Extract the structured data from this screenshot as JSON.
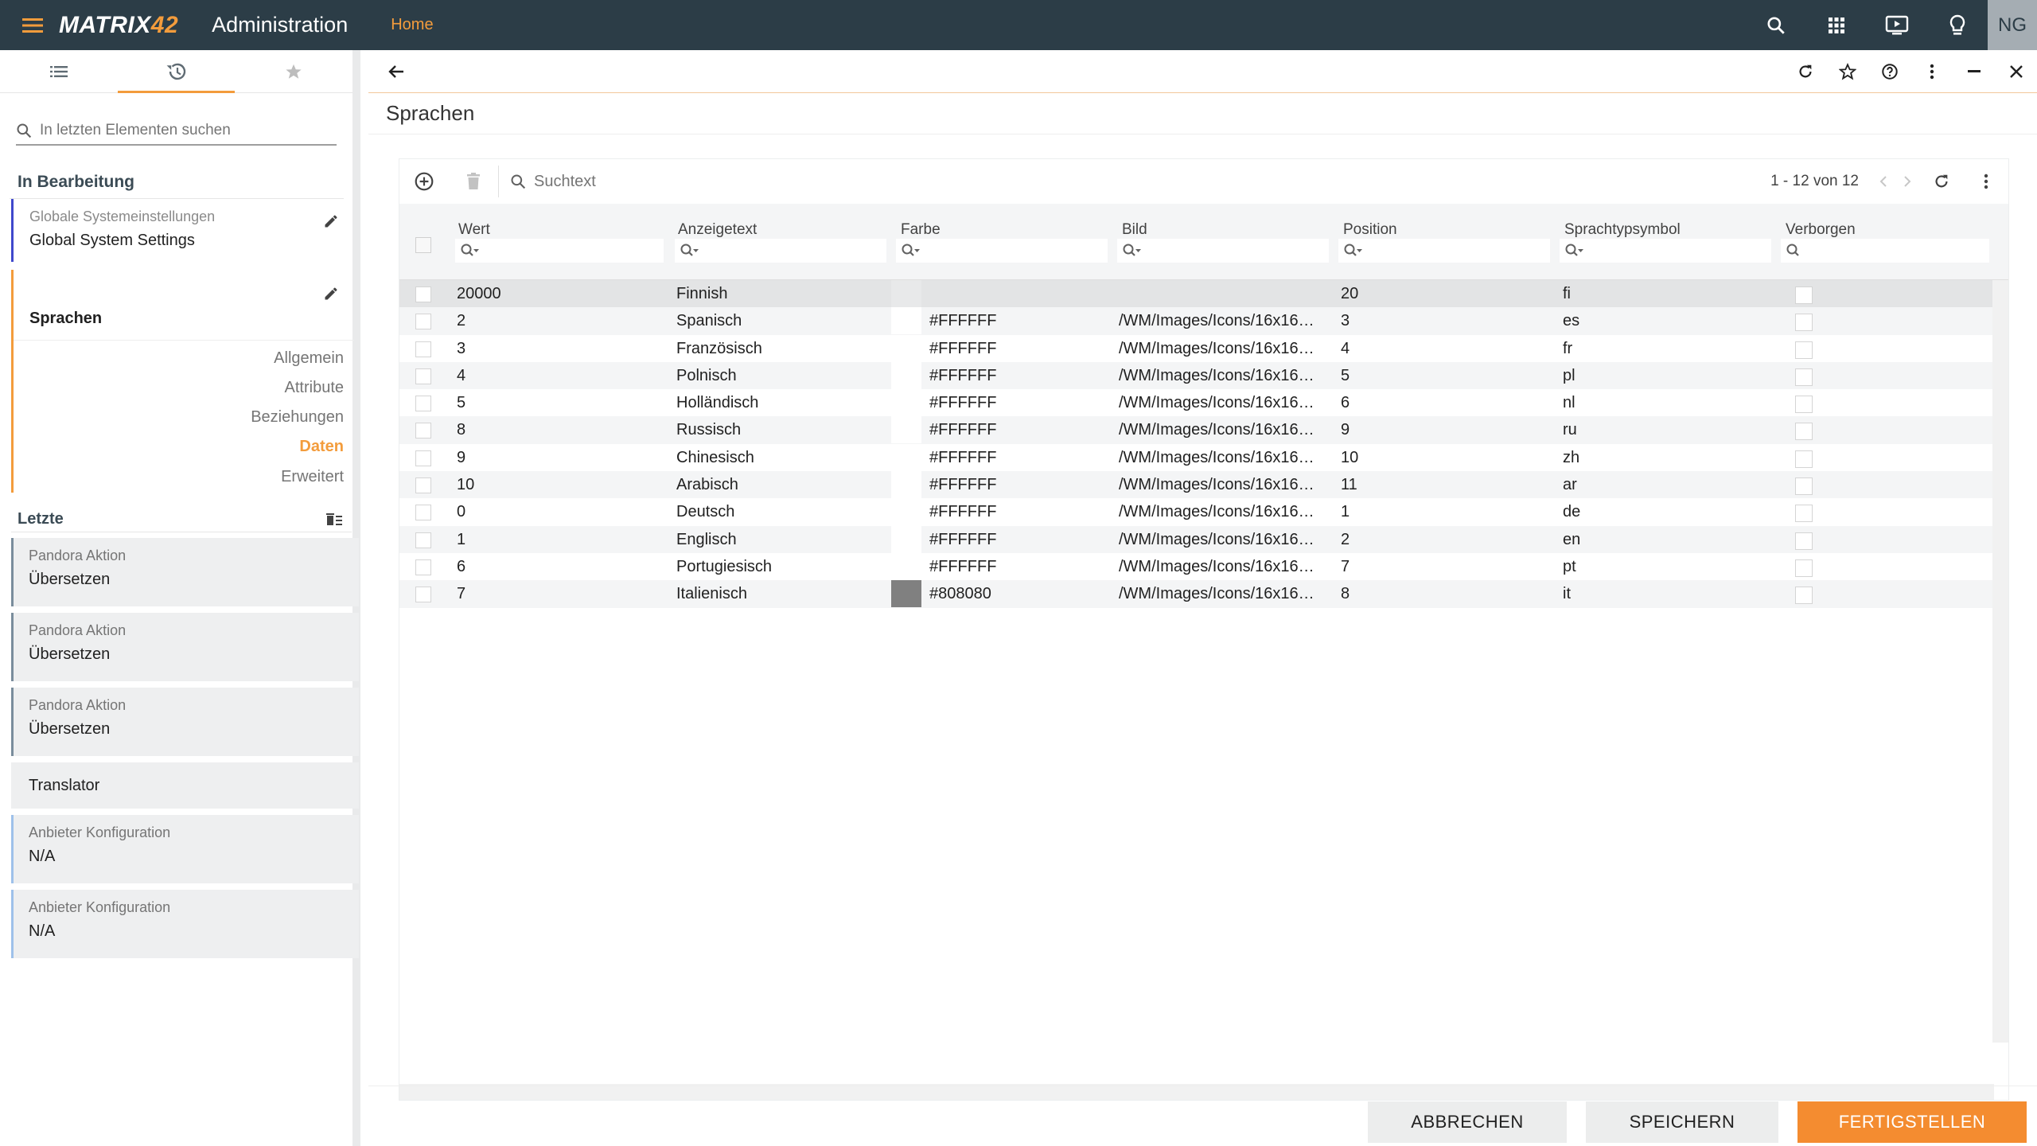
{
  "topbar": {
    "logo_main": "MATRIX",
    "logo_num": "42",
    "app_title": "Administration",
    "home_link": "Home",
    "user_initials": "NG",
    "icons": [
      "menu-icon",
      "search-icon",
      "apps-grid-icon",
      "presentation-icon",
      "lightbulb-icon"
    ]
  },
  "sidebar": {
    "tabs": [
      "list-icon",
      "history-icon",
      "star-icon"
    ],
    "search_placeholder": "In letzten Elementen suchen",
    "in_edit_heading": "In Bearbeitung",
    "edit_items": [
      {
        "small": "Globale Systemeinstellungen",
        "big": "Global System Settings"
      }
    ],
    "current_item": {
      "title": "Sprachen",
      "subnav": [
        "Allgemein",
        "Attribute",
        "Beziehungen",
        "Daten",
        "Erweitert"
      ],
      "active_subnav": "Daten"
    },
    "recent_heading": "Letzte",
    "recent_items": [
      {
        "small": "Pandora Aktion",
        "big": "Übersetzen"
      },
      {
        "small": "Pandora Aktion",
        "big": "Übersetzen"
      },
      {
        "small": "Pandora Aktion",
        "big": "Übersetzen"
      },
      {
        "small": "",
        "big": "Translator"
      },
      {
        "small": "Anbieter Konfiguration",
        "big": "N/A"
      },
      {
        "small": "Anbieter Konfiguration",
        "big": "N/A"
      }
    ]
  },
  "main": {
    "page_title": "Sprachen",
    "grid": {
      "search_placeholder": "Suchtext",
      "pager": "1 - 12 von 12",
      "columns": [
        "Wert",
        "Anzeigetext",
        "Farbe",
        "Bild",
        "Position",
        "Sprachtypsymbol",
        "Verborgen"
      ],
      "rows": [
        {
          "wert": "20000",
          "text": "Finnish",
          "farbe": "",
          "swatch": "",
          "bild": "",
          "position": "20",
          "symbol": "fi"
        },
        {
          "wert": "2",
          "text": "Spanisch",
          "farbe": "#FFFFFF",
          "swatch": "#FFFFFF",
          "bild": "/WM/Images/Icons/16x16…",
          "position": "3",
          "symbol": "es"
        },
        {
          "wert": "3",
          "text": "Französisch",
          "farbe": "#FFFFFF",
          "swatch": "#FFFFFF",
          "bild": "/WM/Images/Icons/16x16…",
          "position": "4",
          "symbol": "fr"
        },
        {
          "wert": "4",
          "text": "Polnisch",
          "farbe": "#FFFFFF",
          "swatch": "#FFFFFF",
          "bild": "/WM/Images/Icons/16x16…",
          "position": "5",
          "symbol": "pl"
        },
        {
          "wert": "5",
          "text": "Holländisch",
          "farbe": "#FFFFFF",
          "swatch": "#FFFFFF",
          "bild": "/WM/Images/Icons/16x16…",
          "position": "6",
          "symbol": "nl"
        },
        {
          "wert": "8",
          "text": "Russisch",
          "farbe": "#FFFFFF",
          "swatch": "#FFFFFF",
          "bild": "/WM/Images/Icons/16x16…",
          "position": "9",
          "symbol": "ru"
        },
        {
          "wert": "9",
          "text": "Chinesisch",
          "farbe": "#FFFFFF",
          "swatch": "#FFFFFF",
          "bild": "/WM/Images/Icons/16x16…",
          "position": "10",
          "symbol": "zh"
        },
        {
          "wert": "10",
          "text": "Arabisch",
          "farbe": "#FFFFFF",
          "swatch": "#FFFFFF",
          "bild": "/WM/Images/Icons/16x16…",
          "position": "11",
          "symbol": "ar"
        },
        {
          "wert": "0",
          "text": "Deutsch",
          "farbe": "#FFFFFF",
          "swatch": "#FFFFFF",
          "bild": "/WM/Images/Icons/16x16…",
          "position": "1",
          "symbol": "de"
        },
        {
          "wert": "1",
          "text": "Englisch",
          "farbe": "#FFFFFF",
          "swatch": "#FFFFFF",
          "bild": "/WM/Images/Icons/16x16…",
          "position": "2",
          "symbol": "en"
        },
        {
          "wert": "6",
          "text": "Portugiesisch",
          "farbe": "#FFFFFF",
          "swatch": "#FFFFFF",
          "bild": "/WM/Images/Icons/16x16…",
          "position": "7",
          "symbol": "pt"
        },
        {
          "wert": "7",
          "text": "Italienisch",
          "farbe": "#808080",
          "swatch": "#808080",
          "bild": "/WM/Images/Icons/16x16…",
          "position": "8",
          "symbol": "it"
        }
      ]
    },
    "footer": {
      "cancel": "ABBRECHEN",
      "save": "SPEICHERN",
      "finish": "FERTIGSTELLEN"
    }
  },
  "colors": {
    "topbar": "#2c3d47",
    "accent": "#f39c3c",
    "edit_marker": "#3f48cc",
    "finish_button": "#f48c30"
  }
}
